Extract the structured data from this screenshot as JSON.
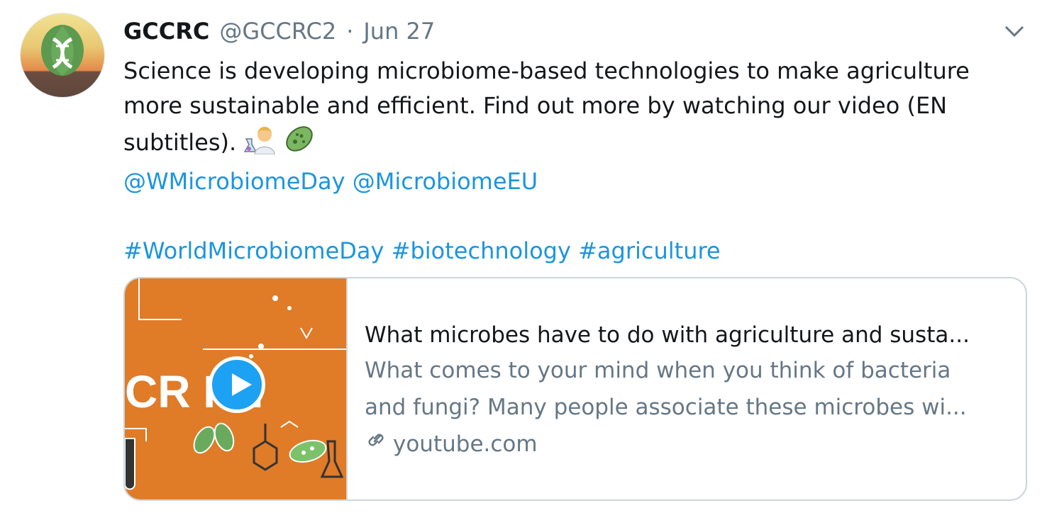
{
  "tweet": {
    "author_name": "GCCRC",
    "handle": "@GCCRC2",
    "separator": "·",
    "date": "Jun 27",
    "text_lines": [
      "Science is developing microbiome-based technologies to make agriculture",
      "more sustainable and efficient. Find out more by watching our video (EN",
      "subtitles)."
    ],
    "emojis": [
      "scientist-emoji",
      "microbe-emoji"
    ],
    "mentions": [
      "@WMicrobiomeDay",
      "@MicrobiomeEU"
    ],
    "hashtags": [
      "#WorldMicrobiomeDay",
      "#biotechnology",
      "#agriculture"
    ]
  },
  "card": {
    "thumbnail_text": "CR    IOI",
    "title": "What microbes have to do with agriculture and susta...",
    "description_lines": [
      "What comes to your mind when you think of bacteria",
      "and fungi? Many people associate these microbes wi..."
    ],
    "domain": "youtube.com"
  },
  "colors": {
    "link": "#1b95e0",
    "secondary_text": "#657786",
    "play_button": "#1da1f2",
    "thumbnail_bg": "#e07b28"
  }
}
